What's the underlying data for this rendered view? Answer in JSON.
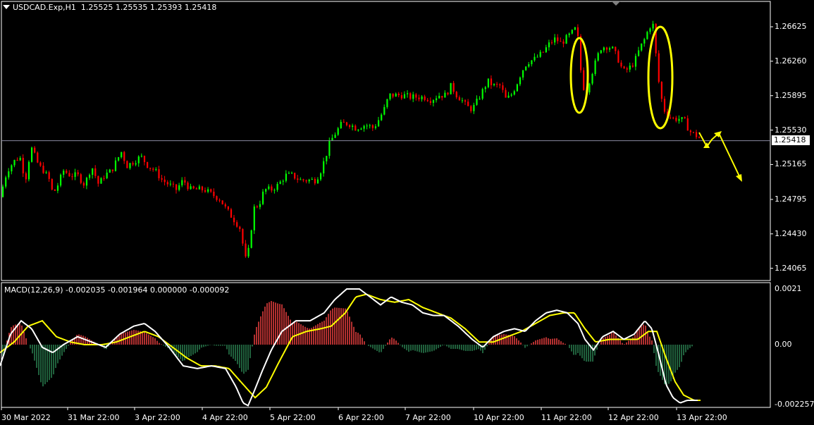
{
  "main_panel": {
    "symbol_label": "USDCAD.Exp,H1",
    "ohlc_label": "1.25525 1.25535 1.25393 1.25418",
    "current_price": "1.25418",
    "price_ticks": [
      "1.26625",
      "1.26260",
      "1.25895",
      "1.25530",
      "1.25165",
      "1.24795",
      "1.24430",
      "1.24065"
    ]
  },
  "macd_panel": {
    "label": "MACD(12,26,9) -0.002035 -0.001964 0.000000 -0.000092",
    "ticks": [
      "0.0021",
      "0.00",
      "-0.002257"
    ]
  },
  "time_axis": {
    "labels": [
      "30 Mar 2022",
      "31 Mar 22:00",
      "3 Apr 22:00",
      "4 Apr 22:00",
      "5 Apr 22:00",
      "6 Apr 22:00",
      "7 Apr 22:00",
      "10 Apr 22:00",
      "11 Apr 22:00",
      "12 Apr 22:00",
      "13 Apr 22:00"
    ]
  },
  "colors": {
    "bull_candle": "#00ff00",
    "bear_candle": "#ff0000",
    "macd_line": "#ffffff",
    "signal_line": "#ffff00",
    "hist_positive": "#ff4444",
    "hist_negative": "#2e8b57",
    "annotation": "#ffff00",
    "grid_frame": "#ffffff"
  },
  "chart_data": [
    {
      "type": "candlestick",
      "price_waypoints": [
        [
          0,
          1.2482
        ],
        [
          10,
          1.251
        ],
        [
          20,
          1.252
        ],
        [
          28,
          1.2525
        ],
        [
          36,
          1.25
        ],
        [
          44,
          1.2535
        ],
        [
          55,
          1.2515
        ],
        [
          62,
          1.251
        ],
        [
          70,
          1.25
        ],
        [
          75,
          1.2485
        ],
        [
          82,
          1.2495
        ],
        [
          90,
          1.251
        ],
        [
          100,
          1.2505
        ],
        [
          110,
          1.2505
        ],
        [
          120,
          1.2495
        ],
        [
          130,
          1.2515
        ],
        [
          140,
          1.2495
        ],
        [
          148,
          1.2505
        ],
        [
          158,
          1.251
        ],
        [
          165,
          1.252
        ],
        [
          172,
          1.253
        ],
        [
          180,
          1.2515
        ],
        [
          190,
          1.252
        ],
        [
          200,
          1.2525
        ],
        [
          210,
          1.2515
        ],
        [
          220,
          1.251
        ],
        [
          230,
          1.25
        ],
        [
          240,
          1.2495
        ],
        [
          250,
          1.249
        ],
        [
          260,
          1.25
        ],
        [
          270,
          1.249
        ],
        [
          280,
          1.249
        ],
        [
          290,
          1.249
        ],
        [
          300,
          1.2485
        ],
        [
          312,
          1.248
        ],
        [
          320,
          1.247
        ],
        [
          330,
          1.246
        ],
        [
          340,
          1.245
        ],
        [
          345,
          1.243
        ],
        [
          350,
          1.241
        ],
        [
          355,
          1.244
        ],
        [
          360,
          1.247
        ],
        [
          368,
          1.2475
        ],
        [
          375,
          1.249
        ],
        [
          385,
          1.249
        ],
        [
          395,
          1.2495
        ],
        [
          405,
          1.2505
        ],
        [
          415,
          1.2505
        ],
        [
          425,
          1.25
        ],
        [
          435,
          1.25
        ],
        [
          448,
          1.25
        ],
        [
          455,
          1.251
        ],
        [
          462,
          1.2525
        ],
        [
          468,
          1.254
        ],
        [
          476,
          1.255
        ],
        [
          485,
          1.256
        ],
        [
          495,
          1.256
        ],
        [
          505,
          1.2555
        ],
        [
          515,
          1.2558
        ],
        [
          522,
          1.2558
        ],
        [
          530,
          1.2555
        ],
        [
          538,
          1.2565
        ],
        [
          545,
          1.2575
        ],
        [
          552,
          1.259
        ],
        [
          560,
          1.259
        ],
        [
          572,
          1.259
        ],
        [
          582,
          1.2588
        ],
        [
          592,
          1.2588
        ],
        [
          602,
          1.2588
        ],
        [
          612,
          1.2585
        ],
        [
          622,
          1.259
        ],
        [
          632,
          1.259
        ],
        [
          640,
          1.26
        ],
        [
          648,
          1.259
        ],
        [
          655,
          1.2585
        ],
        [
          662,
          1.2578
        ],
        [
          670,
          1.2575
        ],
        [
          678,
          1.2585
        ],
        [
          685,
          1.2595
        ],
        [
          692,
          1.2605
        ],
        [
          700,
          1.26
        ],
        [
          710,
          1.26
        ],
        [
          718,
          1.2585
        ],
        [
          725,
          1.259
        ],
        [
          732,
          1.26
        ],
        [
          740,
          1.2615
        ],
        [
          748,
          1.2625
        ],
        [
          758,
          1.2628
        ],
        [
          770,
          1.2635
        ],
        [
          780,
          1.2645
        ],
        [
          788,
          1.265
        ],
        [
          796,
          1.2645
        ],
        [
          803,
          1.265
        ],
        [
          810,
          1.2655
        ],
        [
          816,
          1.266
        ],
        [
          820,
          1.265
        ],
        [
          826,
          1.26
        ],
        [
          832,
          1.2595
        ],
        [
          838,
          1.261
        ],
        [
          845,
          1.2625
        ],
        [
          852,
          1.264
        ],
        [
          860,
          1.2642
        ],
        [
          868,
          1.264
        ],
        [
          876,
          1.263
        ],
        [
          884,
          1.2615
        ],
        [
          892,
          1.2618
        ],
        [
          900,
          1.2625
        ],
        [
          908,
          1.264
        ],
        [
          915,
          1.265
        ],
        [
          920,
          1.266
        ],
        [
          926,
          1.2668
        ],
        [
          931,
          1.263
        ],
        [
          936,
          1.2595
        ],
        [
          942,
          1.2575
        ],
        [
          948,
          1.2568
        ],
        [
          956,
          1.2565
        ],
        [
          964,
          1.2565
        ],
        [
          972,
          1.2562
        ],
        [
          978,
          1.2552
        ],
        [
          986,
          1.2548
        ],
        [
          990,
          1.2546
        ],
        [
          996,
          1.2542
        ]
      ]
    },
    {
      "type": "line",
      "series": [
        {
          "name": "MACD",
          "points": [
            [
              0,
              -0.0008
            ],
            [
              15,
              0.0004
            ],
            [
              30,
              0.0009
            ],
            [
              45,
              0.0006
            ],
            [
              60,
              -0.0001
            ],
            [
              75,
              -0.0003
            ],
            [
              90,
              0.0
            ],
            [
              110,
              0.0003
            ],
            [
              130,
              0.0001
            ],
            [
              150,
              -0.0001
            ],
            [
              170,
              0.0004
            ],
            [
              190,
              0.0007
            ],
            [
              205,
              0.0008
            ],
            [
              220,
              0.0005
            ],
            [
              240,
              -0.0001
            ],
            [
              260,
              -0.0008
            ],
            [
              280,
              -0.0009
            ],
            [
              300,
              -0.0008
            ],
            [
              320,
              -0.0009
            ],
            [
              335,
              -0.0016
            ],
            [
              345,
              -0.0022
            ],
            [
              352,
              -0.0023
            ],
            [
              360,
              -0.0018
            ],
            [
              372,
              -0.001
            ],
            [
              385,
              -0.0002
            ],
            [
              400,
              0.0005
            ],
            [
              420,
              0.0009
            ],
            [
              440,
              0.0009
            ],
            [
              460,
              0.0012
            ],
            [
              475,
              0.0017
            ],
            [
              492,
              0.0021
            ],
            [
              510,
              0.0021
            ],
            [
              525,
              0.0018
            ],
            [
              540,
              0.0015
            ],
            [
              555,
              0.0018
            ],
            [
              570,
              0.0016
            ],
            [
              585,
              0.0015
            ],
            [
              600,
              0.0012
            ],
            [
              615,
              0.0011
            ],
            [
              630,
              0.0011
            ],
            [
              650,
              0.0007
            ],
            [
              670,
              0.0002
            ],
            [
              685,
              -0.0001
            ],
            [
              700,
              0.0003
            ],
            [
              715,
              0.0005
            ],
            [
              730,
              0.0006
            ],
            [
              745,
              0.0005
            ],
            [
              760,
              0.0009
            ],
            [
              775,
              0.0012
            ],
            [
              790,
              0.0013
            ],
            [
              805,
              0.0012
            ],
            [
              820,
              0.0008
            ],
            [
              830,
              0.0002
            ],
            [
              842,
              -0.0002
            ],
            [
              855,
              0.0003
            ],
            [
              870,
              0.0005
            ],
            [
              885,
              0.0002
            ],
            [
              900,
              0.0004
            ],
            [
              915,
              0.0009
            ],
            [
              925,
              0.0006
            ],
            [
              935,
              -0.0004
            ],
            [
              945,
              -0.0015
            ],
            [
              955,
              -0.002
            ],
            [
              965,
              -0.0022
            ],
            [
              975,
              -0.0021
            ],
            [
              990,
              -0.0021
            ]
          ]
        },
        {
          "name": "Signal",
          "points": [
            [
              0,
              -0.0003
            ],
            [
              20,
              0.0001
            ],
            [
              40,
              0.0007
            ],
            [
              60,
              0.0009
            ],
            [
              80,
              0.0003
            ],
            [
              100,
              0.0001
            ],
            [
              120,
              0.0
            ],
            [
              145,
              0.0
            ],
            [
              165,
              0.0001
            ],
            [
              185,
              0.0003
            ],
            [
              205,
              0.0005
            ],
            [
              225,
              0.0003
            ],
            [
              245,
              -0.0001
            ],
            [
              265,
              -0.0005
            ],
            [
              285,
              -0.0008
            ],
            [
              305,
              -0.0008
            ],
            [
              325,
              -0.0009
            ],
            [
              345,
              -0.0015
            ],
            [
              362,
              -0.002
            ],
            [
              378,
              -0.0016
            ],
            [
              395,
              -0.0007
            ],
            [
              415,
              0.0003
            ],
            [
              435,
              0.0005
            ],
            [
              455,
              0.0006
            ],
            [
              470,
              0.0007
            ],
            [
              490,
              0.0012
            ],
            [
              505,
              0.0018
            ],
            [
              520,
              0.0019
            ],
            [
              540,
              0.0017
            ],
            [
              560,
              0.0016
            ],
            [
              580,
              0.0017
            ],
            [
              600,
              0.0014
            ],
            [
              620,
              0.0012
            ],
            [
              640,
              0.001
            ],
            [
              660,
              0.0006
            ],
            [
              680,
              0.0001
            ],
            [
              700,
              0.0001
            ],
            [
              720,
              0.0003
            ],
            [
              740,
              0.0005
            ],
            [
              760,
              0.0008
            ],
            [
              780,
              0.0011
            ],
            [
              800,
              0.0012
            ],
            [
              815,
              0.0012
            ],
            [
              830,
              0.0006
            ],
            [
              845,
              0.0001
            ],
            [
              865,
              0.0002
            ],
            [
              885,
              0.0002
            ],
            [
              905,
              0.0002
            ],
            [
              920,
              0.0005
            ],
            [
              932,
              0.0005
            ],
            [
              945,
              -0.0005
            ],
            [
              958,
              -0.0014
            ],
            [
              970,
              -0.0019
            ],
            [
              985,
              -0.0021
            ],
            [
              995,
              -0.0021
            ]
          ]
        }
      ]
    }
  ]
}
